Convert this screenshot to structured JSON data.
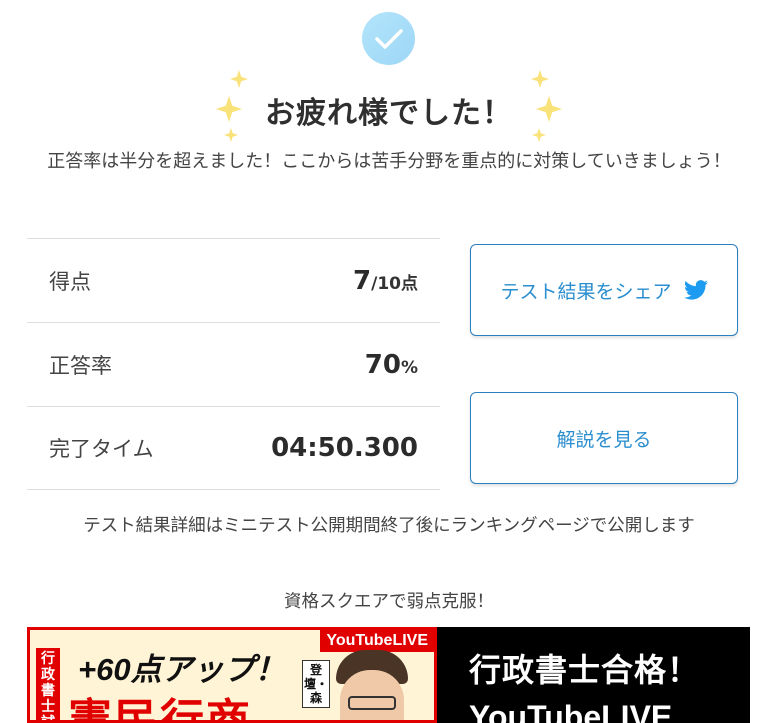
{
  "header": {
    "title": "お疲れ様でした！",
    "message": "正答率は半分を超えました！ここからは苦手分野を重点的に対策していきましょう！"
  },
  "stats": [
    {
      "label": "得点",
      "value": "7",
      "unit": "/10点"
    },
    {
      "label": "正答率",
      "value": "70",
      "unit": "%"
    },
    {
      "label": "完了タイム",
      "value": "04:50.300",
      "unit": ""
    }
  ],
  "buttons": {
    "share_label": "テスト結果をシェア",
    "explain_label": "解説を見る"
  },
  "note": "テスト結果詳細はミニテスト公開期間終了後にランキングページで公開します",
  "promo": {
    "heading": "資格スクエアで弱点克服！",
    "banner_tag": "YouTubeLIVE",
    "banner_vertical": "行政書士試",
    "banner_catch": "+60点アップ！",
    "banner_big": "憲民行商",
    "banner_speaker": "登壇・森",
    "banner_right_line1": "行政書士合格！",
    "banner_right_line2": "YouTubeLIVE"
  },
  "colors": {
    "accent": "#2a8ecf",
    "check_bg": "#b3e5fb",
    "sparkle": "#f9e27a",
    "banner_red": "#e00000"
  },
  "icons": {
    "check": "check-icon",
    "sparkle": "sparkle-icon",
    "twitter": "twitter-icon"
  }
}
